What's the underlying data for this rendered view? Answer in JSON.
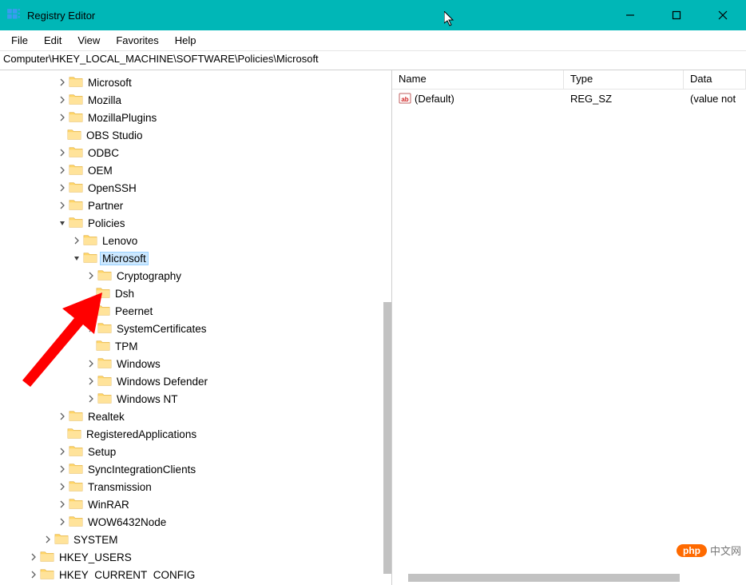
{
  "window": {
    "title": "Registry Editor"
  },
  "menu": {
    "file": "File",
    "edit": "Edit",
    "view": "View",
    "favorites": "Favorites",
    "help": "Help"
  },
  "address": "Computer\\HKEY_LOCAL_MACHINE\\SOFTWARE\\Policies\\Microsoft",
  "tree": [
    {
      "depth": 3,
      "chev": "right",
      "label": "Microsoft"
    },
    {
      "depth": 3,
      "chev": "right",
      "label": "Mozilla"
    },
    {
      "depth": 3,
      "chev": "right",
      "label": "MozillaPlugins"
    },
    {
      "depth": 3,
      "chev": "",
      "label": "OBS Studio"
    },
    {
      "depth": 3,
      "chev": "right",
      "label": "ODBC"
    },
    {
      "depth": 3,
      "chev": "right",
      "label": "OEM"
    },
    {
      "depth": 3,
      "chev": "right",
      "label": "OpenSSH"
    },
    {
      "depth": 3,
      "chev": "right",
      "label": "Partner"
    },
    {
      "depth": 3,
      "chev": "down",
      "label": "Policies"
    },
    {
      "depth": 4,
      "chev": "right",
      "label": "Lenovo"
    },
    {
      "depth": 4,
      "chev": "down",
      "label": "Microsoft",
      "selected": true
    },
    {
      "depth": 5,
      "chev": "right",
      "label": "Cryptography"
    },
    {
      "depth": 5,
      "chev": "",
      "label": "Dsh"
    },
    {
      "depth": 5,
      "chev": "",
      "label": "Peernet"
    },
    {
      "depth": 5,
      "chev": "right",
      "label": "SystemCertificates"
    },
    {
      "depth": 5,
      "chev": "",
      "label": "TPM"
    },
    {
      "depth": 5,
      "chev": "right",
      "label": "Windows"
    },
    {
      "depth": 5,
      "chev": "right",
      "label": "Windows Defender"
    },
    {
      "depth": 5,
      "chev": "right",
      "label": "Windows NT"
    },
    {
      "depth": 3,
      "chev": "right",
      "label": "Realtek"
    },
    {
      "depth": 3,
      "chev": "",
      "label": "RegisteredApplications"
    },
    {
      "depth": 3,
      "chev": "right",
      "label": "Setup"
    },
    {
      "depth": 3,
      "chev": "right",
      "label": "SyncIntegrationClients"
    },
    {
      "depth": 3,
      "chev": "right",
      "label": "Transmission"
    },
    {
      "depth": 3,
      "chev": "right",
      "label": "WinRAR"
    },
    {
      "depth": 3,
      "chev": "right",
      "label": "WOW6432Node"
    },
    {
      "depth": 2,
      "chev": "right",
      "label": "SYSTEM"
    },
    {
      "depth": 1,
      "chev": "right",
      "label": "HKEY_USERS"
    },
    {
      "depth": 1,
      "chev": "right",
      "label": "HKEY_CURRENT_CONFIG"
    }
  ],
  "list": {
    "cols": {
      "name": "Name",
      "type": "Type",
      "data": "Data"
    },
    "rows": [
      {
        "name": "(Default)",
        "type": "REG_SZ",
        "data": "(value not"
      }
    ]
  },
  "watermark": {
    "badge": "php",
    "text": "中文网"
  }
}
